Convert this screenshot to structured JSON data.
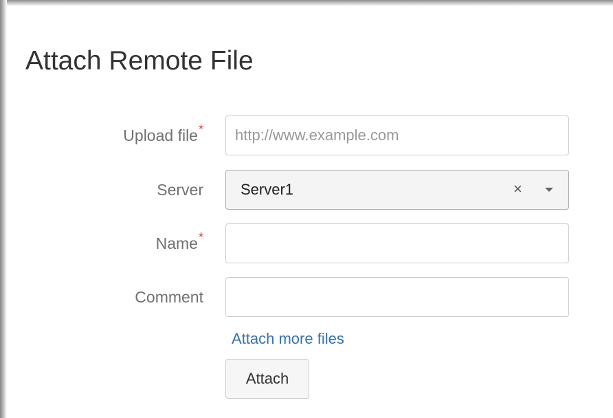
{
  "dialog": {
    "title": "Attach Remote File"
  },
  "form": {
    "upload_file": {
      "label": "Upload file",
      "required_mark": "*",
      "placeholder": "http://www.example.com",
      "value": ""
    },
    "server": {
      "label": "Server",
      "selected": "Server1",
      "clear_glyph": "×",
      "icons": [
        "clear-icon",
        "chevron-down-icon"
      ]
    },
    "name": {
      "label": "Name",
      "required_mark": "*",
      "value": ""
    },
    "comment": {
      "label": "Comment",
      "value": ""
    },
    "attach_more_link": "Attach more files",
    "attach_button": "Attach"
  },
  "colors": {
    "title": "#333333",
    "label": "#707070",
    "required": "#d04437",
    "link": "#3572b0"
  }
}
